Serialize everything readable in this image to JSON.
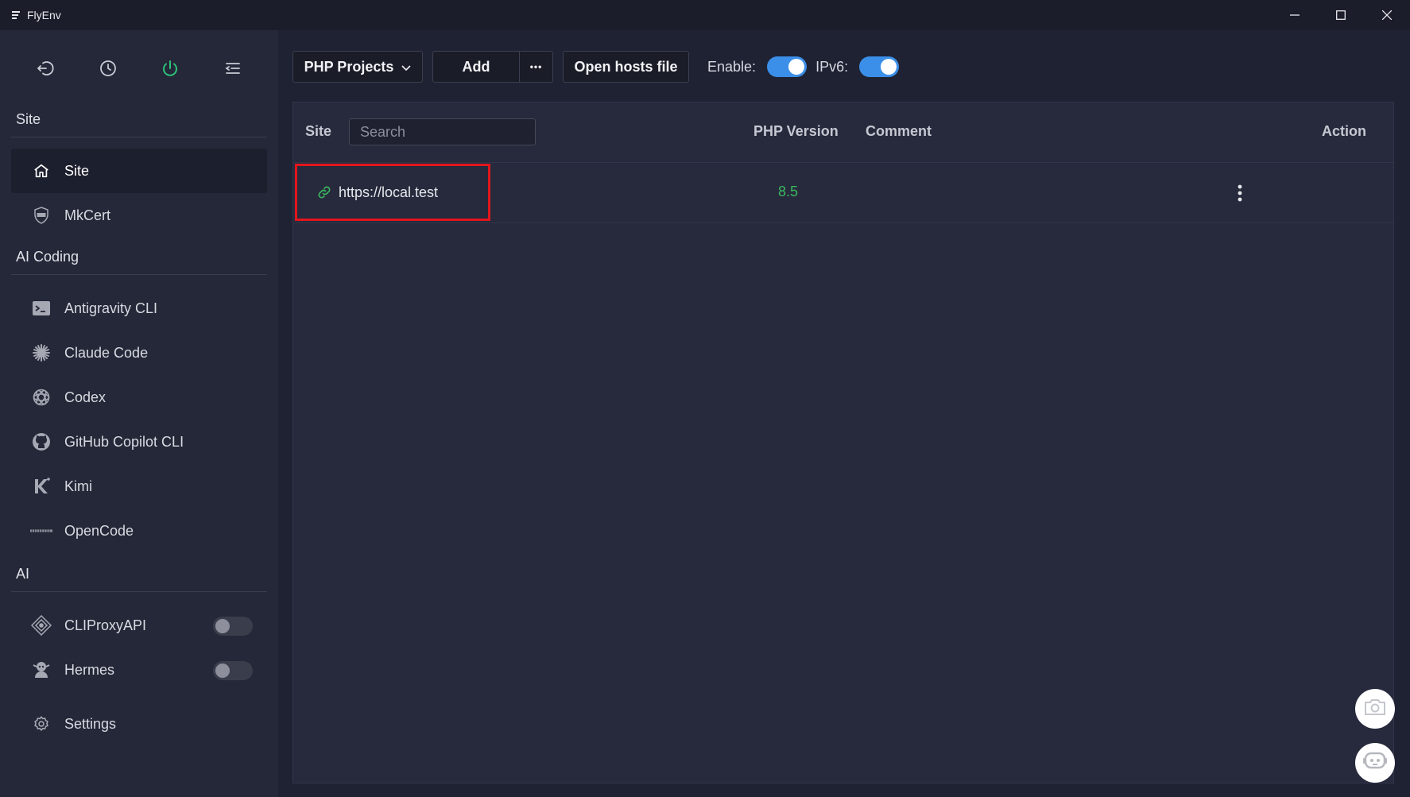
{
  "app": {
    "title": "FlyEnv"
  },
  "sidebar": {
    "sections": [
      {
        "title": "Site",
        "items": [
          {
            "label": "Site",
            "icon": "home-icon",
            "active": true
          },
          {
            "label": "MkCert",
            "icon": "certificate-icon"
          }
        ]
      },
      {
        "title": "AI Coding",
        "items": [
          {
            "label": "Antigravity CLI",
            "icon": "terminal-icon"
          },
          {
            "label": "Claude Code",
            "icon": "claude-starburst-icon"
          },
          {
            "label": "Codex",
            "icon": "openai-knot-icon"
          },
          {
            "label": "GitHub Copilot CLI",
            "icon": "github-icon"
          },
          {
            "label": "Kimi",
            "icon": "kimi-k-icon"
          },
          {
            "label": "OpenCode",
            "icon": "opencode-wordmark-icon"
          }
        ]
      },
      {
        "title": "AI",
        "items": [
          {
            "label": "CLIProxyAPI",
            "icon": "diamond-network-icon",
            "toggle": false
          },
          {
            "label": "Hermes",
            "icon": "hermes-figure-icon",
            "toggle": false
          }
        ]
      }
    ],
    "settings_label": "Settings"
  },
  "toolbar": {
    "project_type": "PHP Projects",
    "add_label": "Add",
    "more_label": "•••",
    "open_hosts_label": "Open hosts file",
    "enable_label": "Enable:",
    "enable_on": true,
    "ipv6_label": "IPv6:",
    "ipv6_on": true
  },
  "table": {
    "columns": {
      "site": "Site",
      "php_version": "PHP Version",
      "comment": "Comment",
      "action": "Action"
    },
    "search_placeholder": "Search",
    "rows": [
      {
        "url": "https://local.test",
        "php_version": "8.5",
        "comment": ""
      }
    ]
  },
  "colors": {
    "accent": "#3b8fe8",
    "php_version": "#3bb75f",
    "highlight": "#e3161d",
    "power_icon": "#2bc27a"
  }
}
